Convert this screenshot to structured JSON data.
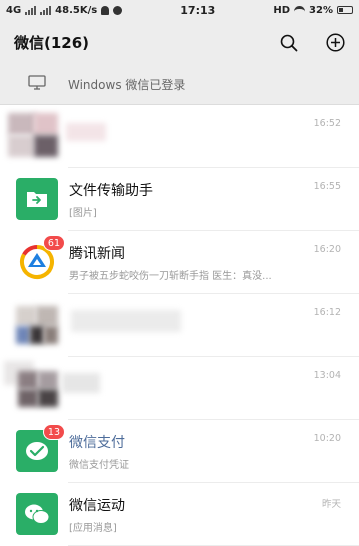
{
  "status_bar": {
    "network_left": "4G",
    "speed": "48.5K/s",
    "time": "17:13",
    "hd": "HD",
    "battery": "32%"
  },
  "header": {
    "title": "微信(126)",
    "search_icon": "search-icon",
    "add_icon": "add-circle-icon"
  },
  "pc_login": {
    "text": "Windows 微信已登录",
    "icon": "monitor-icon"
  },
  "chats": [
    {
      "name": "",
      "preview": "",
      "time": "16:52",
      "blurred": true
    },
    {
      "name": "文件传输助手",
      "preview": "[图片]",
      "time": "16:55",
      "icon": "file-transfer-icon"
    },
    {
      "name": "腾讯新闻",
      "preview": "男子被五步蛇咬伤一刀斩断手指 医生：真没...",
      "time": "16:20",
      "badge": "61",
      "icon": "tencent-news-icon"
    },
    {
      "name": "",
      "preview": "",
      "time": "16:12",
      "blurred": true
    },
    {
      "name": "",
      "preview": "",
      "time": "13:04",
      "blurred": true
    },
    {
      "name": "微信支付",
      "preview": "微信支付凭证",
      "time": "10:20",
      "badge": "13",
      "icon": "wechat-pay-icon"
    },
    {
      "name": "微信运动",
      "preview": "[应用消息]",
      "time": "昨天",
      "icon": "wechat-sport-icon"
    }
  ],
  "colors": {
    "accent_green": "#2aae67",
    "badge_red": "#f24b4b",
    "pay_name_blue": "#4d6c9a",
    "background": "#ededed"
  }
}
